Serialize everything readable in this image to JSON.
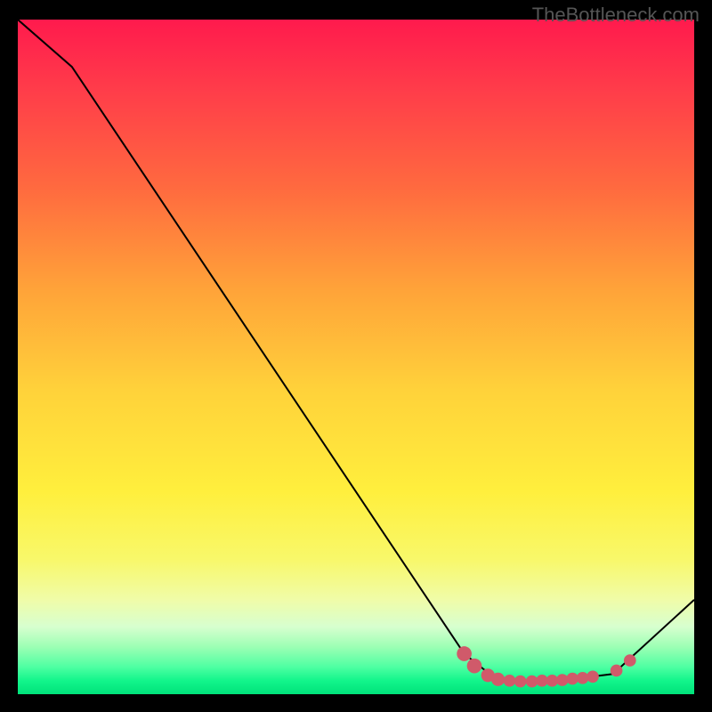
{
  "watermark": "TheBottleneck.com",
  "chart_data": {
    "type": "line",
    "title": "",
    "xlabel": "",
    "ylabel": "",
    "xlim": [
      0,
      100
    ],
    "ylim": [
      0,
      100
    ],
    "line_points": [
      {
        "x": 0,
        "y": 100
      },
      {
        "x": 8,
        "y": 93
      },
      {
        "x": 66,
        "y": 6
      },
      {
        "x": 71,
        "y": 2
      },
      {
        "x": 80,
        "y": 2
      },
      {
        "x": 88,
        "y": 3
      },
      {
        "x": 100,
        "y": 14
      }
    ],
    "markers": [
      {
        "x": 66,
        "y": 6,
        "r": 1.1
      },
      {
        "x": 67.5,
        "y": 4.2,
        "r": 1.1
      },
      {
        "x": 69.5,
        "y": 2.8,
        "r": 1.0
      },
      {
        "x": 71,
        "y": 2.2,
        "r": 1.0
      },
      {
        "x": 72.7,
        "y": 2.0,
        "r": 0.9
      },
      {
        "x": 74.3,
        "y": 1.9,
        "r": 0.9
      },
      {
        "x": 76,
        "y": 1.9,
        "r": 0.9
      },
      {
        "x": 77.5,
        "y": 2.0,
        "r": 0.9
      },
      {
        "x": 79,
        "y": 2.0,
        "r": 0.9
      },
      {
        "x": 80.5,
        "y": 2.1,
        "r": 0.9
      },
      {
        "x": 82,
        "y": 2.3,
        "r": 0.9
      },
      {
        "x": 83.5,
        "y": 2.4,
        "r": 0.9
      },
      {
        "x": 85,
        "y": 2.6,
        "r": 0.9
      },
      {
        "x": 88.5,
        "y": 3.5,
        "r": 0.9
      },
      {
        "x": 90.5,
        "y": 5,
        "r": 0.9
      }
    ],
    "marker_color": "#d05a6a",
    "line_color": "#000000",
    "gradient_stops": [
      {
        "offset": 0,
        "color": "#ff1a4d"
      },
      {
        "offset": 25,
        "color": "#ff6a3f"
      },
      {
        "offset": 55,
        "color": "#ffd23a"
      },
      {
        "offset": 80,
        "color": "#f8f86a"
      },
      {
        "offset": 95,
        "color": "#4dffa2"
      },
      {
        "offset": 100,
        "color": "#00e27a"
      }
    ]
  }
}
